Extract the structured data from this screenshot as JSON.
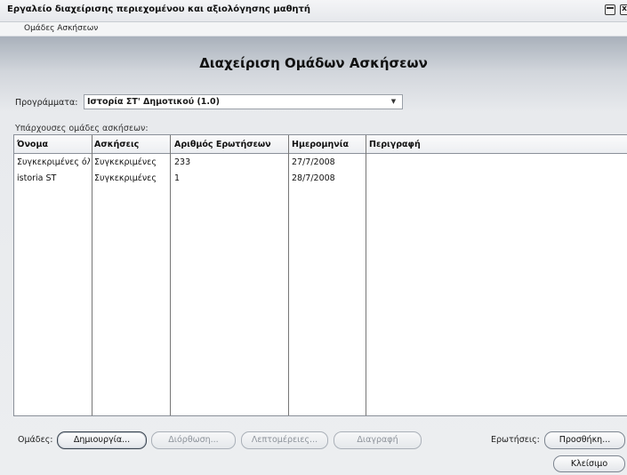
{
  "window": {
    "title": "Εργαλείο διαχείρισης περιεχομένου και αξιολόγησης μαθητή",
    "close_glyph": "x"
  },
  "menu": {
    "items": [
      {
        "label": "Ομάδες Ασκήσεων"
      }
    ]
  },
  "main": {
    "heading": "Διαχείριση Ομάδων Ασκήσεων",
    "program_label": "Προγράμματα:",
    "program_value": "Ιστορία ΣΤ' Δημοτικού (1.0)",
    "existing_label": "Υπάρχουσες ομάδες ασκήσεων:"
  },
  "table": {
    "columns": [
      "Όνομα",
      "Ασκήσεις",
      "Αριθμός Ερωτήσεων",
      "Ημερομηνία",
      "Περιγραφή"
    ],
    "rows": [
      [
        "Συγκεκριμένες όλε",
        "Συγκεκριμένες",
        "233",
        "27/7/2008",
        ""
      ],
      [
        "istoria ST",
        "Συγκεκριμένες",
        "1",
        "28/7/2008",
        ""
      ]
    ]
  },
  "footer": {
    "groups_label": "Ομάδες:",
    "create": "Δημιουργία...",
    "edit": "Διόρθωση...",
    "details": "Λεπτομέρειες...",
    "delete": "Διαγραφή",
    "questions_label": "Ερωτήσεις:",
    "add": "Προσθήκη...",
    "close": "Κλείσιμο"
  },
  "colors": {
    "panel_top": "#a9b1bb",
    "panel_bottom": "#eceef0",
    "border": "#8a9099"
  }
}
